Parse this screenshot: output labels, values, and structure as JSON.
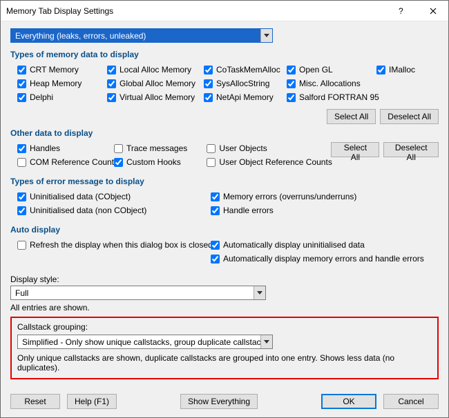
{
  "title": "Memory Tab Display Settings",
  "topCombo": "Everything (leaks, errors, unleaked)",
  "sections": {
    "memTypes": "Types of memory data to display",
    "otherData": "Other data to display",
    "errorTypes": "Types of error message to display",
    "autoDisplay": "Auto display"
  },
  "mem": {
    "crt": "CRT Memory",
    "heap": "Heap Memory",
    "delphi": "Delphi",
    "local": "Local Alloc Memory",
    "global": "Global Alloc Memory",
    "virtual": "Virtual Alloc Memory",
    "cotask": "CoTaskMemAlloc",
    "sysalloc": "SysAllocString",
    "netapi": "NetApi Memory",
    "opengl": "Open GL",
    "misc": "Misc. Allocations",
    "salford": "Salford FORTRAN 95",
    "imalloc": "IMalloc"
  },
  "other": {
    "handles": "Handles",
    "comref": "COM Reference Counts",
    "trace": "Trace messages",
    "custom": "Custom Hooks",
    "userobj": "User Objects",
    "userobjref": "User Object Reference Counts"
  },
  "err": {
    "unin_c": "Uninitialised data (CObject)",
    "unin_nc": "Uninitialised data (non CObject)",
    "memerr": "Memory errors (overruns/underruns)",
    "handleerr": "Handle errors"
  },
  "auto": {
    "refresh": "Refresh the display when this dialog box is closed.",
    "uninit": "Automatically display uninitialised data",
    "memhandle": "Automatically display memory errors and handle errors"
  },
  "displayStyleLabel": "Display style:",
  "displayStyleValue": "Full",
  "allEntries": "All entries are shown.",
  "callstackLabel": "Callstack grouping:",
  "callstackValue": "Simplified - Only show unique callstacks, group duplicate callstacks",
  "callstackNote": "Only unique callstacks are shown, duplicate callstacks are grouped into one entry. Shows less data (no duplicates).",
  "buttons": {
    "selectAll": "Select All",
    "deselectAll": "Deselect All",
    "reset": "Reset",
    "help": "Help (F1)",
    "showEverything": "Show Everything",
    "ok": "OK",
    "cancel": "Cancel"
  }
}
